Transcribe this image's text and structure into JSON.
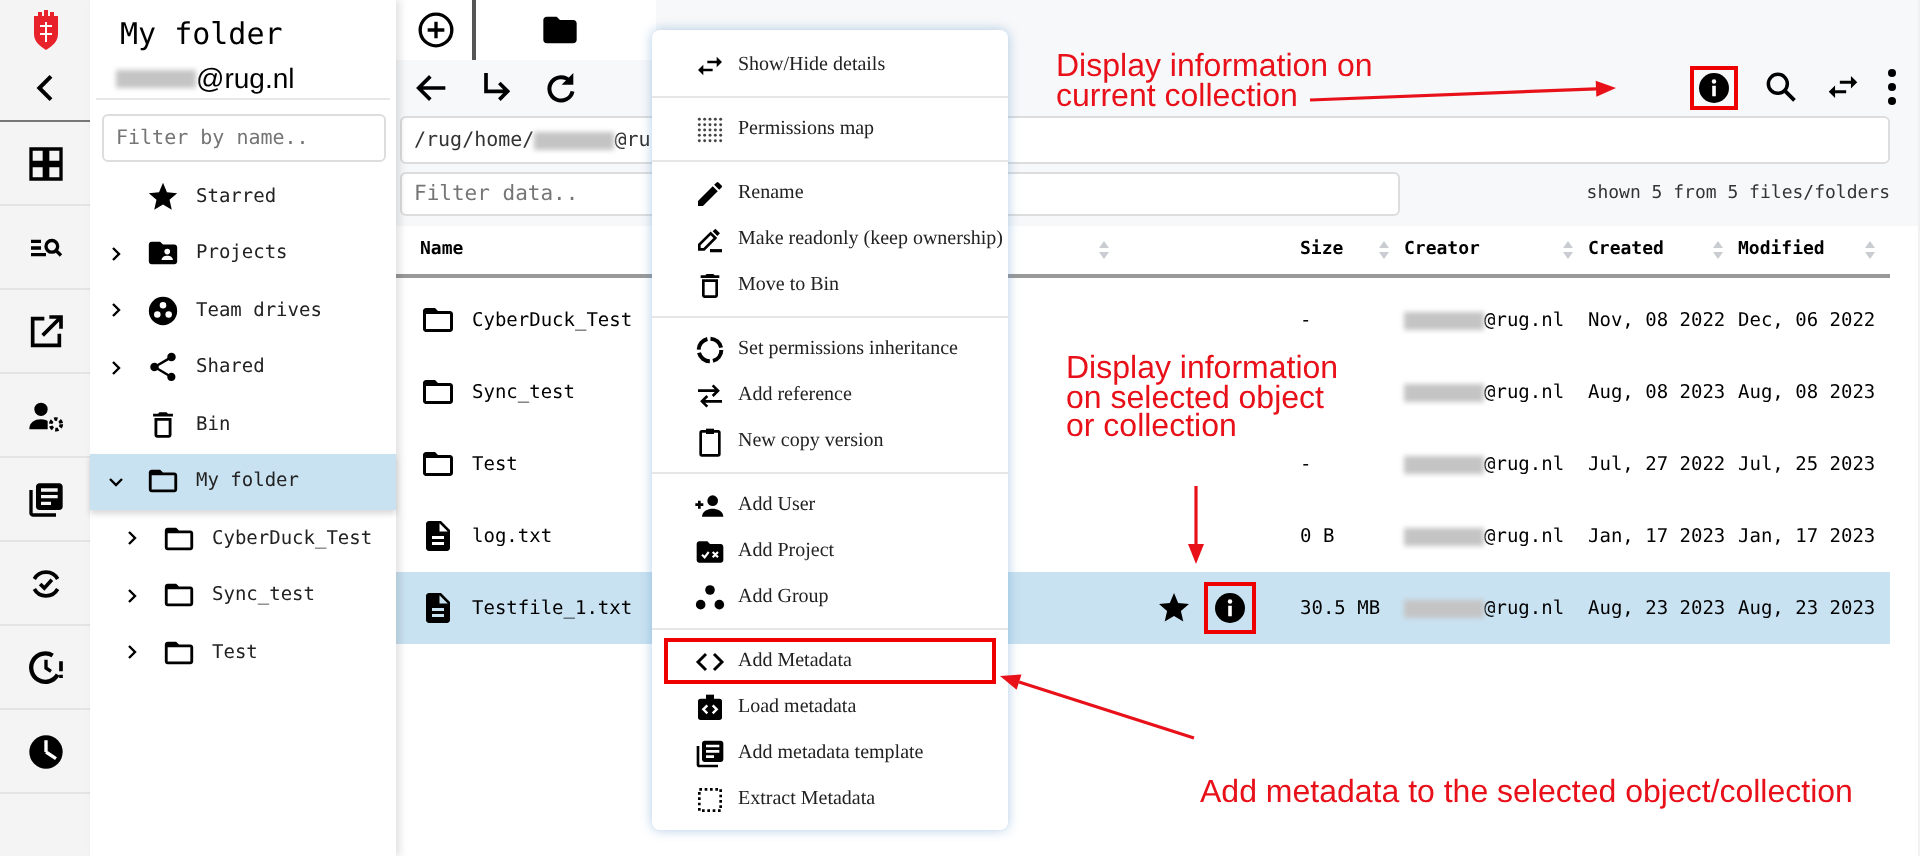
{
  "sidebar": {
    "title": "My folder",
    "account_suffix": "@rug.nl",
    "filter": {
      "placeholder": "Filter by name.."
    },
    "tree": [
      {
        "label": "Starred",
        "selected": false
      },
      {
        "label": "Projects",
        "expanded": false,
        "selected": false
      },
      {
        "label": "Team drives",
        "expanded": false,
        "selected": false
      },
      {
        "label": "Shared",
        "expanded": false,
        "selected": false
      },
      {
        "label": "Bin",
        "selected": false
      },
      {
        "label": "My folder",
        "expanded": true,
        "selected": true,
        "children": [
          {
            "label": "CyberDuck_Test",
            "expanded": false,
            "selected": false
          },
          {
            "label": "Sync_test",
            "expanded": false,
            "selected": false
          },
          {
            "label": "Test",
            "expanded": false,
            "selected": false
          }
        ]
      }
    ]
  },
  "browser": {
    "info_button_highlighted": true,
    "path": {
      "prefix": "/rug/home/",
      "suffix": "@ru"
    },
    "filter": {
      "placeholder": "Filter data.."
    },
    "summary": "shown 5 from 5 files/folders",
    "table": {
      "columns": [
        "Name",
        "Size",
        "Creator",
        "Created",
        "Modified"
      ],
      "rows": [
        {
          "kind": "folder",
          "name": "CyberDuck_Test",
          "size": "-",
          "creator_suffix": "@rug.nl",
          "created": "Nov, 08 2022",
          "modified": "Dec, 06 2022",
          "selected": false
        },
        {
          "kind": "folder",
          "name": "Sync_test",
          "creator_suffix": "@rug.nl",
          "created": "Aug, 08 2023",
          "modified": "Aug, 08 2023",
          "selected": false
        },
        {
          "kind": "folder",
          "name": "Test",
          "size": "-",
          "creator_suffix": "@rug.nl",
          "created": "Jul, 27 2022",
          "modified": "Jul, 25 2023",
          "selected": false
        },
        {
          "kind": "file",
          "name": "log.txt",
          "size": "0 B",
          "creator_suffix": "@rug.nl",
          "created": "Jan, 17 2023",
          "modified": "Jan, 17 2023",
          "selected": false
        },
        {
          "kind": "file",
          "name": "Testfile_1.txt",
          "size": "30.5 MB",
          "creator_suffix": "@rug.nl",
          "created": "Aug, 23 2023",
          "modified": "Aug, 23 2023",
          "selected": true,
          "info_highlighted": true
        }
      ]
    }
  },
  "context_menu": {
    "groups": [
      [
        {
          "label": "Show/Hide details",
          "highlighted": false
        }
      ],
      [
        {
          "label": "Permissions map",
          "highlighted": false
        }
      ],
      [
        {
          "label": "Rename",
          "highlighted": false
        },
        {
          "label": "Make readonly (keep ownership)",
          "highlighted": false
        },
        {
          "label": "Move to Bin",
          "highlighted": false
        }
      ],
      [
        {
          "label": "Set permissions inheritance",
          "highlighted": false
        },
        {
          "label": "Add reference",
          "highlighted": false
        },
        {
          "label": "New copy version",
          "highlighted": false
        }
      ],
      [
        {
          "label": "Add User",
          "highlighted": false
        },
        {
          "label": "Add Project",
          "highlighted": false
        },
        {
          "label": "Add Group",
          "highlighted": false
        }
      ],
      [
        {
          "label": "Add Metadata",
          "highlighted": true
        },
        {
          "label": "Load metadata",
          "highlighted": false
        },
        {
          "label": "Add metadata template",
          "highlighted": false
        },
        {
          "label": "Extract Metadata",
          "highlighted": false
        }
      ]
    ]
  },
  "annotations": [
    {
      "text": "Display information on current collection"
    },
    {
      "text": "Display information on selected object or collection"
    },
    {
      "text": "Add metadata to the selected object/collection"
    }
  ]
}
